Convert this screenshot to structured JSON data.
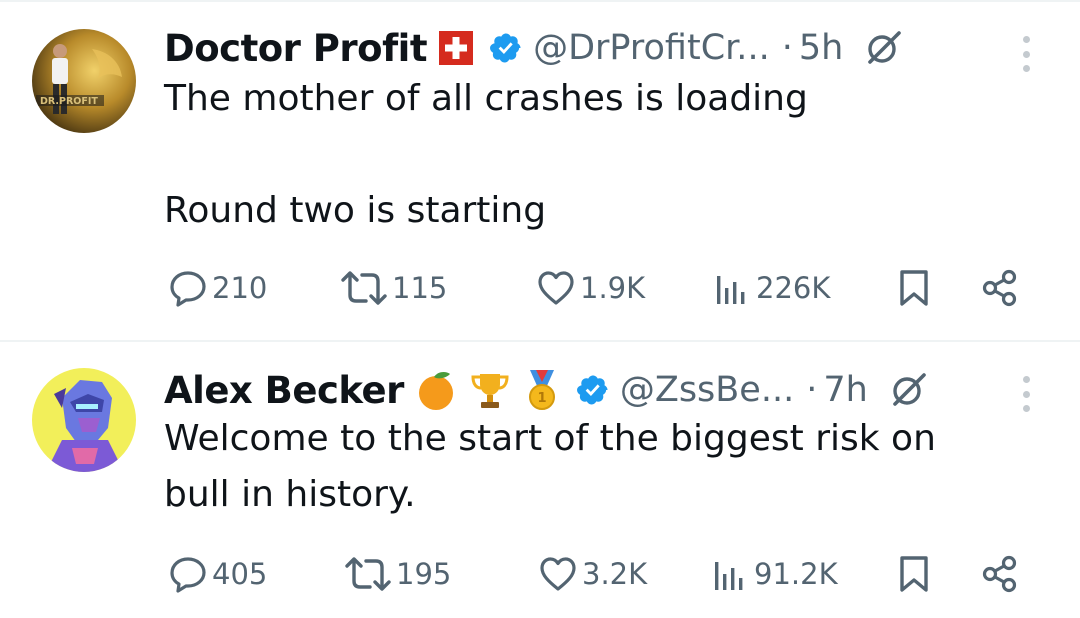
{
  "tweets": [
    {
      "name": "Doctor Profit",
      "flag": "🇨🇭",
      "handle": "@DrProfitCr...",
      "dot": "·",
      "time": "5h",
      "avatar_text": "DR.PROFIT",
      "lines": [
        "The mother of all crashes is loading",
        "",
        "Round two is starting"
      ],
      "replies": "210",
      "reposts": "115",
      "likes": "1.9K",
      "views": "226K"
    },
    {
      "name": "Alex Becker",
      "emojis": [
        "orange-emoji",
        "trophy-emoji",
        "gold-medal-emoji"
      ],
      "handle": "@ZssBe...",
      "dot": "·",
      "time": "7h",
      "lines": [
        "Welcome to the start of the biggest risk on",
        "bull in history."
      ],
      "replies": "405",
      "reposts": "195",
      "likes": "3.2K",
      "views": "91.2K"
    }
  ],
  "colors": {
    "text": "#0f1419",
    "secondary": "#536471",
    "verified": "#1d9bf0",
    "divider": "#eff3f4"
  },
  "icons": [
    "verified-badge-icon",
    "grok-icon",
    "more-icon",
    "reply-icon",
    "repost-icon",
    "like-icon",
    "views-icon",
    "bookmark-icon",
    "share-icon"
  ]
}
